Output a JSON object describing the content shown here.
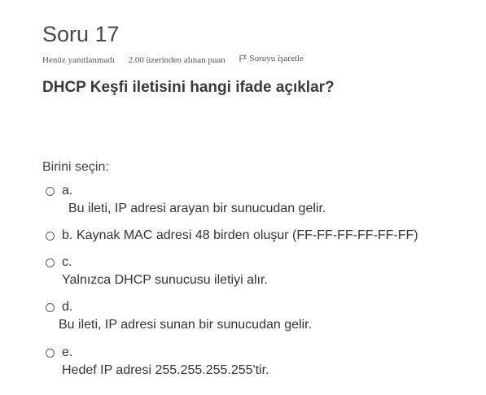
{
  "question": {
    "number_label": "Soru 17",
    "status": "Henüz yanıtlanmadı",
    "mark": "2.00 üzerinden alınan puan",
    "flag_label": "Soruyu işaretle",
    "text": "DHCP Keşfi iletisini hangi ifade açıklar?",
    "prompt": "Birini seçin:"
  },
  "answers": [
    {
      "letter": "a.",
      "text": "Bu ileti, IP adresi arayan bir sunucudan gelir."
    },
    {
      "letter": "b.",
      "text": "Kaynak MAC adresi 48 birden oluşur (FF-FF-FF-FF-FF-FF)"
    },
    {
      "letter": "c.",
      "text": "Yalnızca DHCP sunucusu iletiyi alır."
    },
    {
      "letter": "d.",
      "text": "Bu ileti, IP adresi sunan bir sunucudan gelir."
    },
    {
      "letter": "e.",
      "text": "Hedef IP adresi 255.255.255.255'tir."
    }
  ],
  "icons": {
    "flag": "flag-icon",
    "radio": "radio-button"
  },
  "colors": {
    "text": "#333333",
    "heading": "#3a3a3a"
  }
}
